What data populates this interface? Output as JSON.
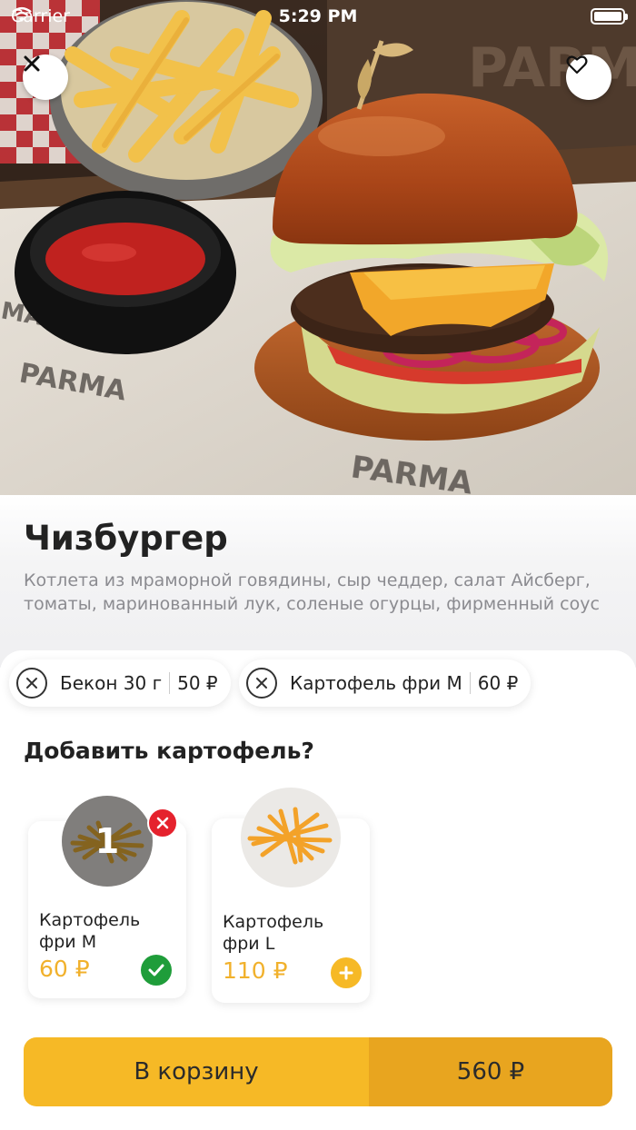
{
  "status_bar": {
    "carrier": "Carrier",
    "time": "5:29 PM"
  },
  "product": {
    "title": "Чизбургер",
    "description": "Котлета из мраморной говядины, сыр чеддер, салат Айсберг, томаты, маринованный лук, соленые огурцы, фирменный соус"
  },
  "selected_options": [
    {
      "name": "Бекон 30 г",
      "price": "50 ₽"
    },
    {
      "name": "Картофель фри M",
      "price": "60 ₽"
    }
  ],
  "addon_section": {
    "title": "Добавить картофель?",
    "items": [
      {
        "name": "Картофель фри M",
        "price": "60 ₽",
        "quantity": "1",
        "selected": true
      },
      {
        "name": "Картофель фри L",
        "price": "110 ₽",
        "selected": false
      }
    ]
  },
  "cart": {
    "label": "В корзину",
    "total": "560 ₽"
  },
  "colors": {
    "accent": "#f6b926",
    "accent_dark": "#e8a51f",
    "price": "#f1b12c",
    "remove": "#e5222d",
    "selected": "#1f9d3a"
  },
  "icons": {
    "close": "close-icon",
    "favorite": "heart-icon",
    "remove_chip": "close-circle-icon",
    "remove_addon": "close-icon",
    "selected_addon": "check-icon",
    "add_addon": "plus-icon"
  }
}
